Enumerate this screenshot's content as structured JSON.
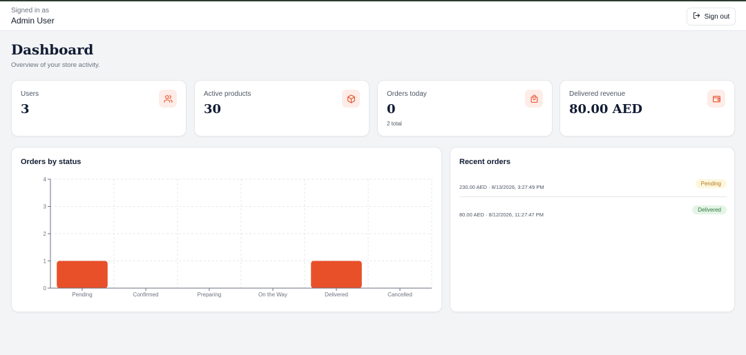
{
  "header": {
    "signed_in_label": "Signed in as",
    "user_name": "Admin User",
    "sign_out_label": "Sign out"
  },
  "page": {
    "title": "Dashboard",
    "subtitle": "Overview of your store activity."
  },
  "stats": [
    {
      "label": "Users",
      "value": "3",
      "note": "",
      "icon": "users-icon"
    },
    {
      "label": "Active products",
      "value": "30",
      "note": "",
      "icon": "package-icon"
    },
    {
      "label": "Orders today",
      "value": "0",
      "note": "2 total",
      "icon": "shopping-bag-icon"
    },
    {
      "label": "Delivered revenue",
      "value": "80.00 AED",
      "note": "",
      "icon": "wallet-icon"
    }
  ],
  "orders_panel": {
    "title": "Orders by status"
  },
  "recent_orders": {
    "title": "Recent orders",
    "items": [
      {
        "text": "230.00 AED · 8/13/2026, 3:27:49 PM",
        "status": "Pending"
      },
      {
        "text": "80.00 AED · 8/12/2026, 11:27:47 PM",
        "status": "Delivered"
      }
    ]
  },
  "colors": {
    "accent": "#e8502a",
    "icon_bg": "#fdece7",
    "pending_bg": "#fdf6dc",
    "pending_text": "#b7791f",
    "delivered_bg": "#e3f4e6",
    "delivered_text": "#2f7a3b"
  },
  "chart_data": {
    "type": "bar",
    "categories": [
      "Pending",
      "Confirmed",
      "Preparing",
      "On the Way",
      "Delivered",
      "Cancelled"
    ],
    "values": [
      1,
      0,
      0,
      0,
      1,
      0
    ],
    "ylim": [
      0,
      4
    ],
    "yticks": [
      0,
      1,
      2,
      3,
      4
    ],
    "grid": true,
    "color": "#e8502a"
  }
}
